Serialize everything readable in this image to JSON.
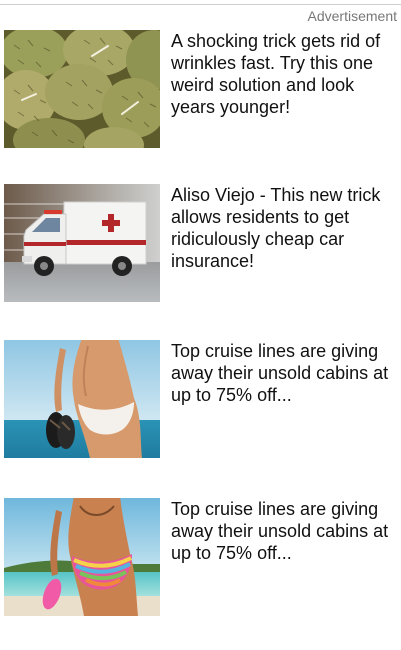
{
  "header": {
    "ad_label": "Advertisement"
  },
  "ads": [
    {
      "text": "A shocking trick gets rid of wrinkles fast. Try this one weird solution and look years younger!",
      "image_icon": "durian-fruit-photo"
    },
    {
      "text": "Aliso Viejo - This new trick allows residents to get ridiculously cheap car insurance!",
      "image_icon": "ambulance-photo"
    },
    {
      "text": "Top cruise lines are giving away their unsold cabins at up to 75% off...",
      "image_icon": "beach-woman-sandals-photo"
    },
    {
      "text": "Top cruise lines are giving away their unsold cabins at up to 75% off...",
      "image_icon": "beach-woman-bikini-photo"
    }
  ],
  "colors": {
    "ad_label": "#777777",
    "ad_text": "#111111",
    "rule": "#cfcfcf"
  }
}
